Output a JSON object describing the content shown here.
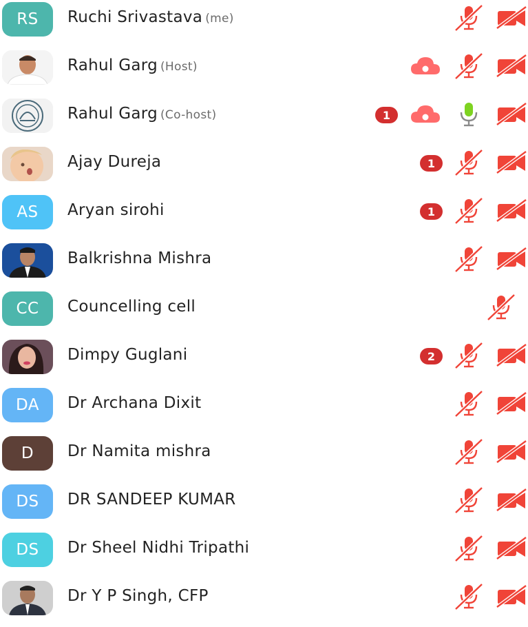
{
  "participants": [
    {
      "initials": "RS",
      "avatar_color": "#4db6ac",
      "name": "Ruchi Srivastava",
      "tag": "(me)",
      "badge": "",
      "mic": "muted",
      "cam": true,
      "cloud": false
    },
    {
      "initials": "",
      "avatar_kind": "photo-man-white-shirt",
      "name": "Rahul Garg",
      "tag": "(Host)",
      "badge": "",
      "mic": "muted",
      "cam": true,
      "cloud": true
    },
    {
      "initials": "",
      "avatar_kind": "emblem-seal",
      "name": "Rahul Garg",
      "tag": "(Co-host)",
      "badge": "1",
      "mic": "on",
      "cam": true,
      "cloud": true
    },
    {
      "initials": "",
      "avatar_kind": "photo-baby",
      "name": "Ajay Dureja",
      "tag": "",
      "badge": "1",
      "mic": "muted",
      "cam": true,
      "cloud": false
    },
    {
      "initials": "AS",
      "avatar_color": "#4fc3f7",
      "name": "Aryan sirohi",
      "tag": "",
      "badge": "1",
      "mic": "muted",
      "cam": true,
      "cloud": false
    },
    {
      "initials": "",
      "avatar_kind": "photo-man-suit-blue",
      "name": "Balkrishna Mishra",
      "tag": "",
      "badge": "",
      "mic": "muted",
      "cam": true,
      "cloud": false
    },
    {
      "initials": "CC",
      "avatar_color": "#4db6ac",
      "name": "Councelling cell",
      "tag": "",
      "badge": "",
      "mic": "muted-only",
      "cam": false,
      "cloud": false
    },
    {
      "initials": "",
      "avatar_kind": "photo-woman",
      "name": "Dimpy Guglani",
      "tag": "",
      "badge": "2",
      "mic": "muted",
      "cam": true,
      "cloud": false
    },
    {
      "initials": "DA",
      "avatar_color": "#64b5f6",
      "name": "Dr Archana Dixit",
      "tag": "",
      "badge": "",
      "mic": "muted",
      "cam": true,
      "cloud": false
    },
    {
      "initials": "D",
      "avatar_color": "#5d4037",
      "name": "Dr Namita mishra",
      "tag": "",
      "badge": "",
      "mic": "muted",
      "cam": true,
      "cloud": false
    },
    {
      "initials": "DS",
      "avatar_color": "#64b5f6",
      "name": "DR SANDEEP KUMAR",
      "tag": "",
      "badge": "",
      "mic": "muted",
      "cam": true,
      "cloud": false
    },
    {
      "initials": "DS",
      "avatar_color": "#4dd0e1",
      "name": "Dr Sheel Nidhi Tripathi",
      "tag": "",
      "badge": "",
      "mic": "muted",
      "cam": true,
      "cloud": false
    },
    {
      "initials": "",
      "avatar_kind": "photo-man-suit",
      "name": "Dr Y P Singh, CFP",
      "tag": "",
      "badge": "",
      "mic": "muted",
      "cam": true,
      "cloud": false
    }
  ],
  "colors": {
    "muted_red": "#f04438",
    "badge_red": "#d32f2f",
    "mic_on_green": "#7ed321"
  },
  "icons": {
    "mic_muted": "mic-off-icon",
    "mic_on": "mic-icon",
    "cam_off": "video-off-icon",
    "cloud": "cloud-record-icon"
  }
}
